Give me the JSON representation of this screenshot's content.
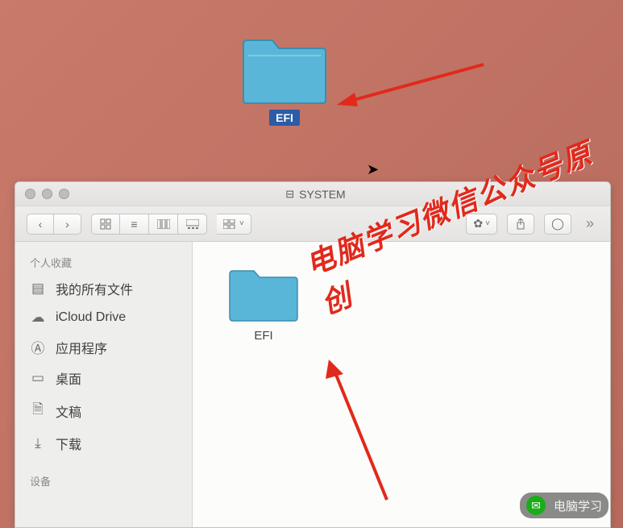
{
  "desktop": {
    "icon_label": "EFI"
  },
  "watermark": "电脑学习微信公众号原创",
  "finder": {
    "window_title": "SYSTEM",
    "sidebar": {
      "section_favorites": "个人收藏",
      "section_devices": "设备",
      "items": [
        {
          "icon": "allfiles",
          "label": "我的所有文件"
        },
        {
          "icon": "cloud",
          "label": "iCloud Drive"
        },
        {
          "icon": "apps",
          "label": "应用程序"
        },
        {
          "icon": "desktop",
          "label": "桌面"
        },
        {
          "icon": "docs",
          "label": "文稿"
        },
        {
          "icon": "downloads",
          "label": "下载"
        }
      ]
    },
    "content": {
      "items": [
        {
          "label": "EFI"
        }
      ]
    }
  },
  "footer": {
    "label": "电脑学习"
  }
}
